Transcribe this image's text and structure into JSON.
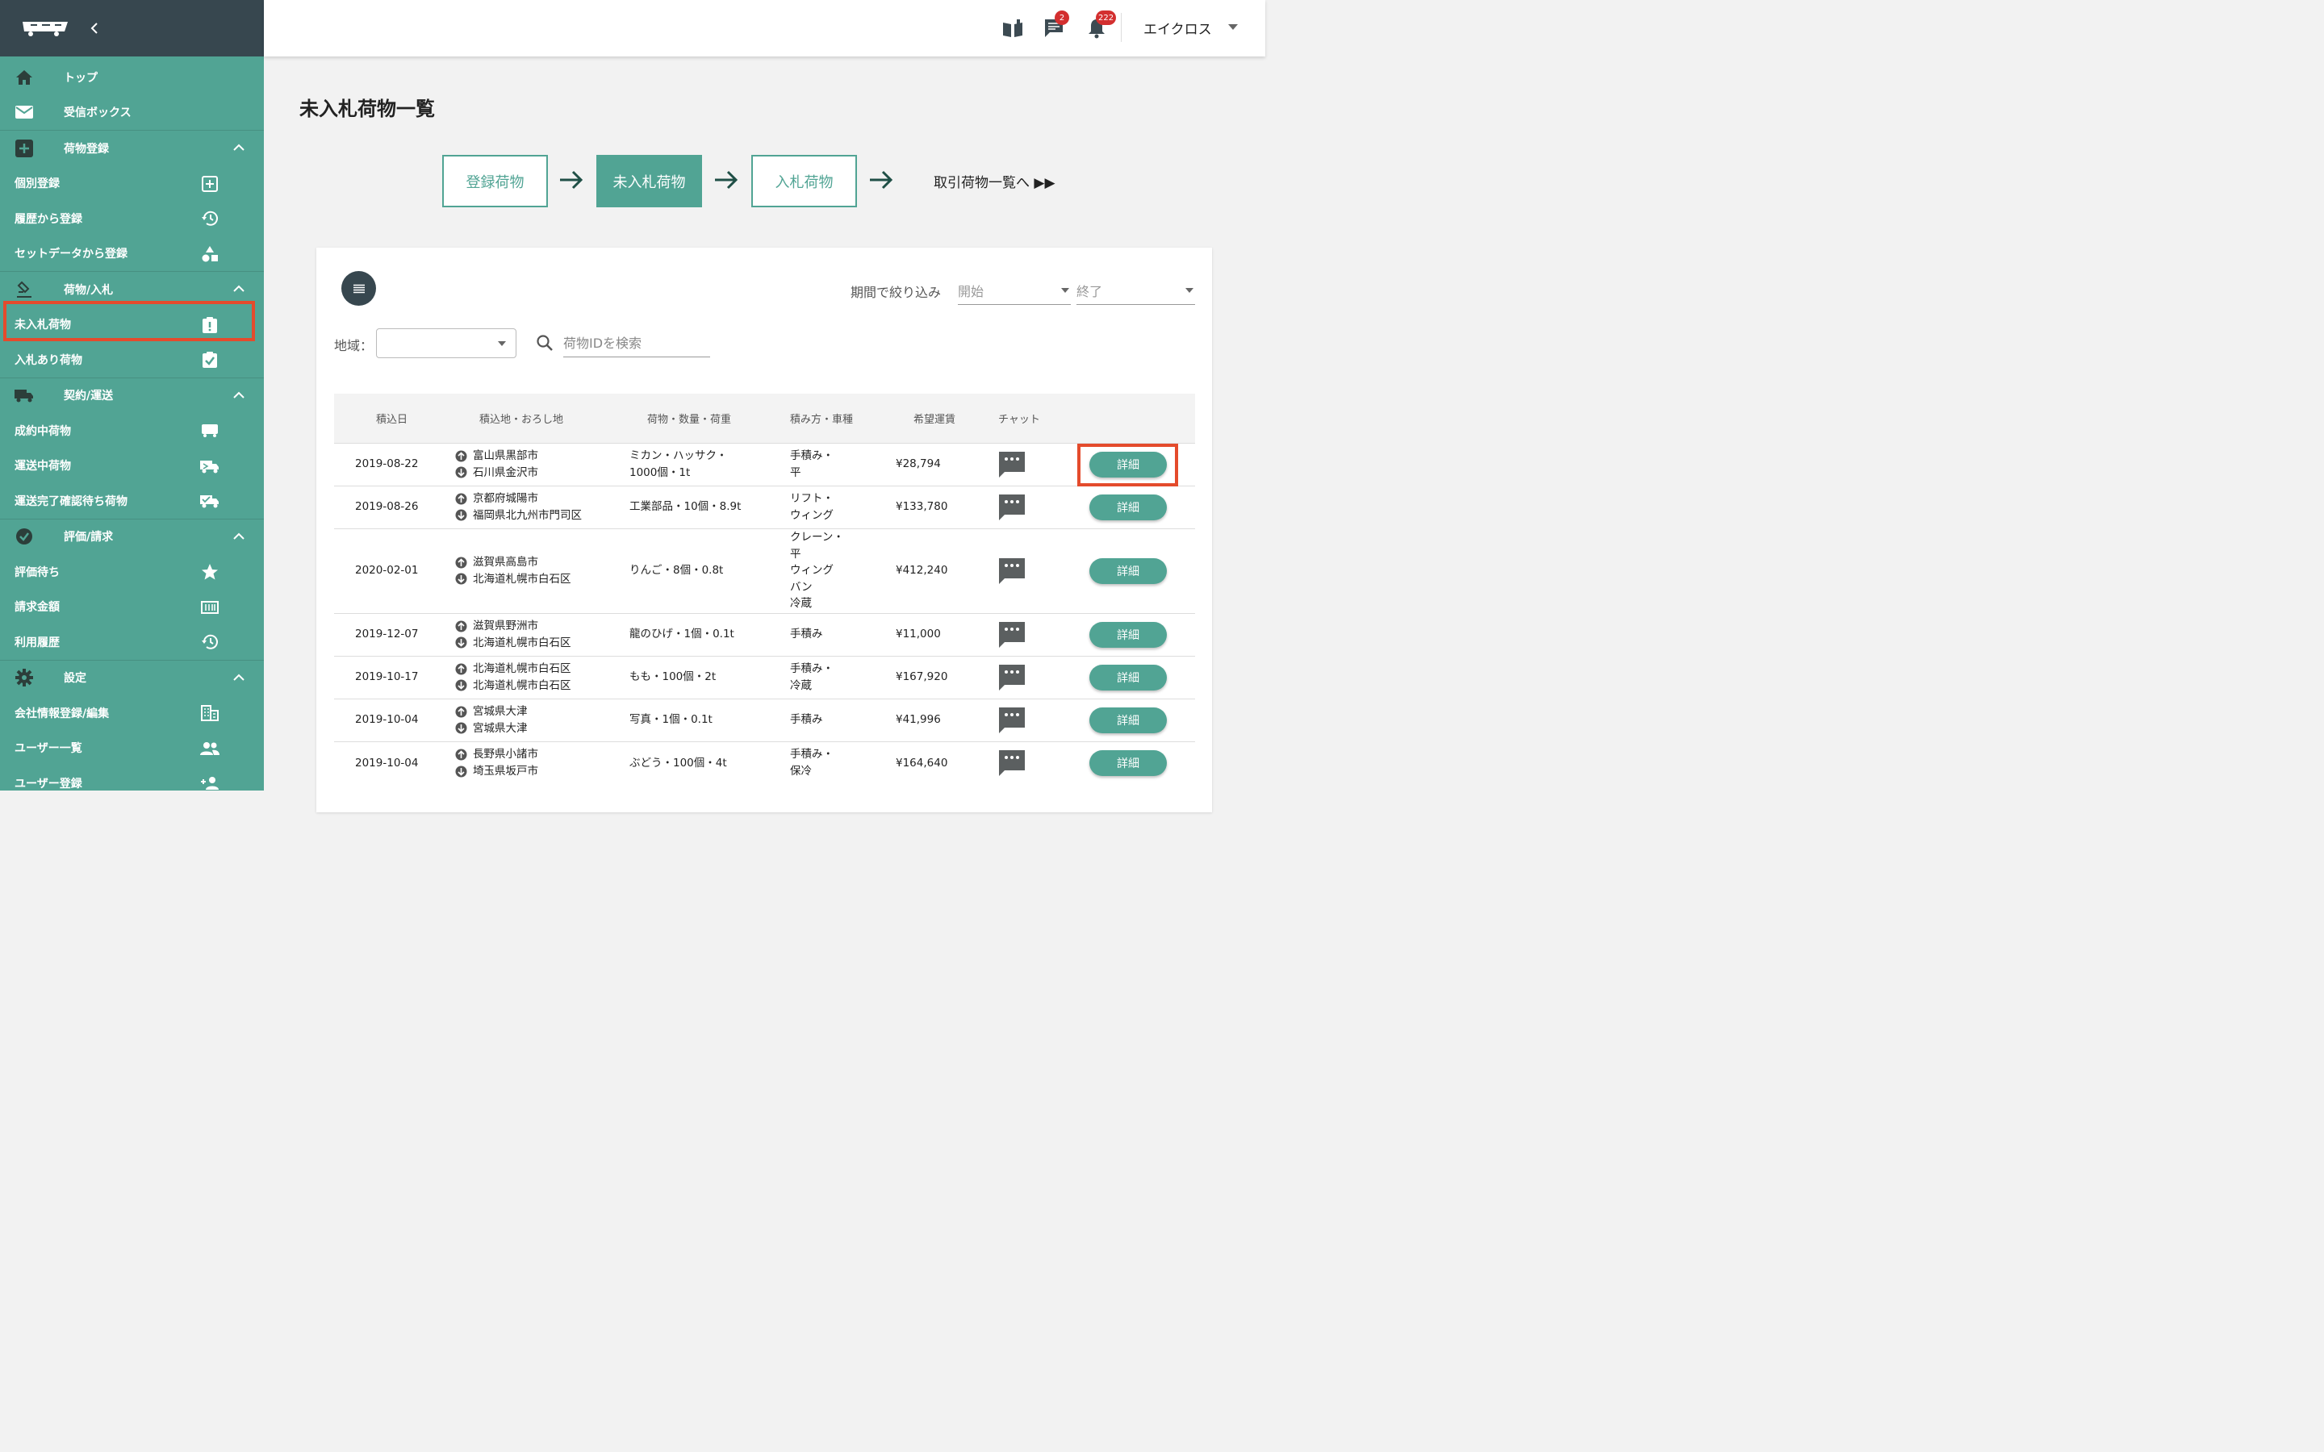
{
  "topbar": {
    "chat_badge": "2",
    "notification_badge": "222",
    "user_name": "エイクロス"
  },
  "sidebar": {
    "top": "トップ",
    "inbox": "受信ボックス",
    "sec_register": "荷物登録",
    "individual": "個別登録",
    "from_history": "履歴から登録",
    "from_setdata": "セットデータから登録",
    "sec_bid": "荷物/入札",
    "unbid": "未入札荷物",
    "with_bid": "入札あり荷物",
    "sec_contract": "契約/運送",
    "contracting": "成約中荷物",
    "in_transit": "運送中荷物",
    "awaiting_confirm": "運送完了確認待ち荷物",
    "sec_review": "評価/請求",
    "awaiting_review": "評価待ち",
    "billing": "請求金額",
    "usage_history": "利用履歴",
    "sec_settings": "設定",
    "company_info": "会社情報登録/編集",
    "user_list": "ユーザー一覧",
    "user_register": "ユーザー登録"
  },
  "page": {
    "title": "未入札荷物一覧",
    "steps": [
      "登録荷物",
      "未入札荷物",
      "入札荷物"
    ],
    "step_link": "取引荷物一覧へ ▶▶"
  },
  "filters": {
    "period_label": "期間で絞り込み",
    "start": "開始",
    "end": "終了",
    "region_label": "地域：",
    "search_placeholder": "荷物IDを検索"
  },
  "table": {
    "headers": [
      "積込日",
      "積込地・おろし地",
      "荷物・数量・荷重",
      "積み方・車種",
      "希望運賃",
      "チャット"
    ],
    "detail_label": "詳細",
    "rows": [
      {
        "date": "2019-08-22",
        "from": "富山県黒部市",
        "to": "石川県金沢市",
        "cargo": "ミカン・ハッサク・\n1000個・1t",
        "method": "手積み・\n平",
        "fare": "¥28,794"
      },
      {
        "date": "2019-08-26",
        "from": "京都府城陽市",
        "to": "福岡県北九州市門司区",
        "cargo": "工業部品・10個・8.9t",
        "method": "リフト・\nウィング",
        "fare": "¥133,780"
      },
      {
        "date": "2020-02-01",
        "from": "滋賀県高島市",
        "to": "北海道札幌市白石区",
        "cargo": "りんご・8個・0.8t",
        "method": "クレーン・\n平\nウィング\nバン\n冷蔵",
        "fare": "¥412,240"
      },
      {
        "date": "2019-12-07",
        "from": "滋賀県野洲市",
        "to": "北海道札幌市白石区",
        "cargo": "龍のひげ・1個・0.1t",
        "method": "手積み",
        "fare": "¥11,000"
      },
      {
        "date": "2019-10-17",
        "from": "北海道札幌市白石区",
        "to": "北海道札幌市白石区",
        "cargo": "もも・100個・2t",
        "method": "手積み・\n冷蔵",
        "fare": "¥167,920"
      },
      {
        "date": "2019-10-04",
        "from": "宮城県大津",
        "to": "宮城県大津",
        "cargo": "写真・1個・0.1t",
        "method": "手積み",
        "fare": "¥41,996"
      },
      {
        "date": "2019-10-04",
        "from": "長野県小諸市",
        "to": "埼玉県坂戸市",
        "cargo": "ぶどう・100個・4t",
        "method": "手積み・\n保冷",
        "fare": "¥164,640"
      }
    ]
  },
  "colors": {
    "primary": "#51a494",
    "sidebar_header": "#37474f",
    "highlight": "#e44b2c",
    "badge": "#d32f2f"
  }
}
